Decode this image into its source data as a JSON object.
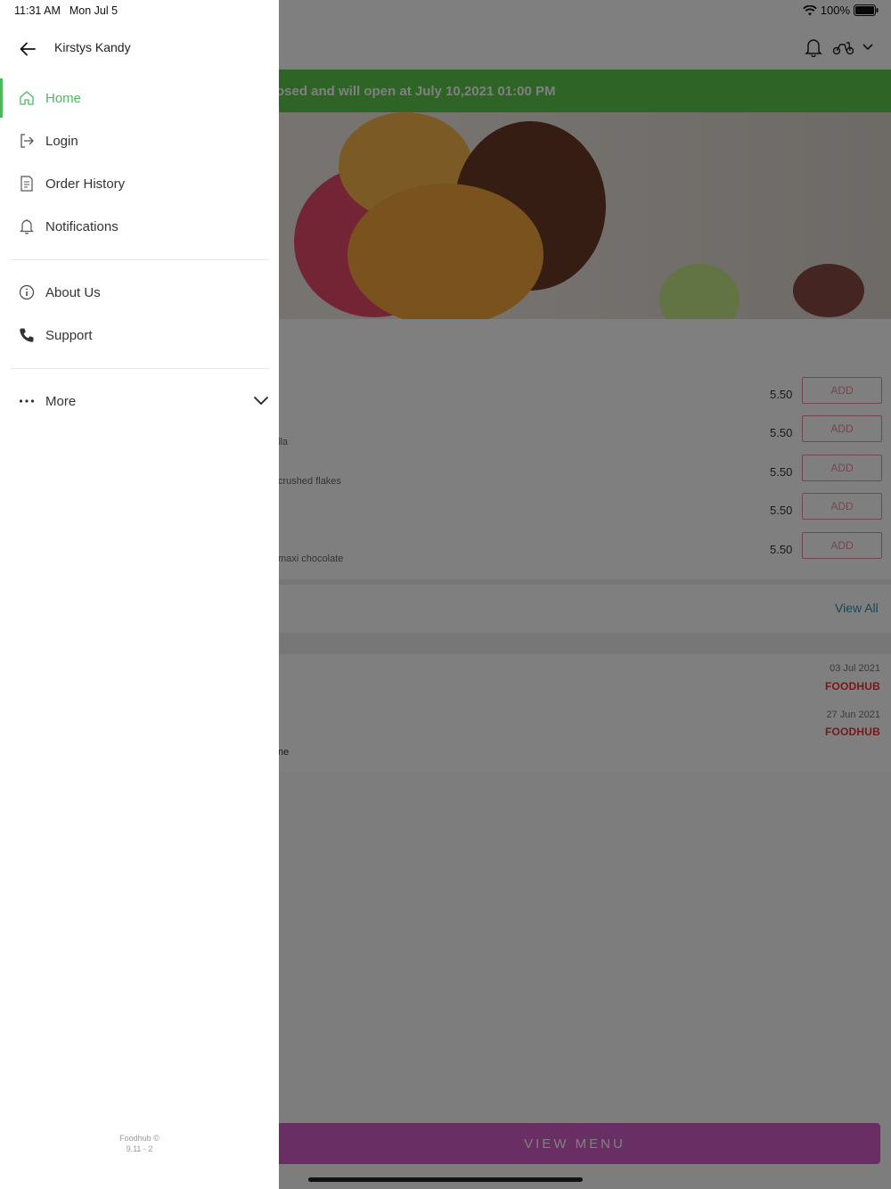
{
  "status_bar": {
    "time": "11:31 AM",
    "date": "Mon Jul 5",
    "battery": "100%"
  },
  "drawer": {
    "store_name": "Kirstys Kandy",
    "nav": [
      {
        "label": "Home",
        "icon": "home-icon",
        "active": true
      },
      {
        "label": "Login",
        "icon": "login-icon",
        "active": false
      },
      {
        "label": "Order History",
        "icon": "receipt-icon",
        "active": false
      },
      {
        "label": "Notifications",
        "icon": "bell-icon",
        "active": false
      }
    ],
    "info": [
      {
        "label": "About Us",
        "icon": "info-icon"
      },
      {
        "label": "Support",
        "icon": "phone-icon"
      }
    ],
    "more": {
      "label": "More",
      "icon": "more-dots-icon"
    },
    "footer": {
      "line1": "Foodhub ©",
      "line2": "9.11 - 2"
    }
  },
  "background": {
    "banner_text": "osed and will open at July 10,2021 01:00 PM",
    "menu_items": [
      {
        "price": "5.50",
        "add_label": "ADD",
        "desc": ""
      },
      {
        "price": "5.50",
        "add_label": "ADD",
        "desc": "lla"
      },
      {
        "price": "5.50",
        "add_label": "ADD",
        "desc": "crushed flakes"
      },
      {
        "price": "5.50",
        "add_label": "ADD",
        "desc": ""
      },
      {
        "price": "5.50",
        "add_label": "ADD",
        "desc": "maxi chocolate"
      }
    ],
    "view_all": "View All",
    "reviews": [
      {
        "date": "03 Jul 2021",
        "source": "FOODHUB",
        "snippet": ""
      },
      {
        "date": "27 Jun 2021",
        "source": "FOODHUB",
        "snippet": "ne"
      }
    ],
    "view_menu": "VIEW MENU"
  },
  "colors": {
    "accent_green": "#4cba5c",
    "banner_green": "#5cc94a",
    "view_menu_purple": "#d35ec9",
    "add_pink": "#e88fa0",
    "link_blue": "#2e8fb0"
  }
}
